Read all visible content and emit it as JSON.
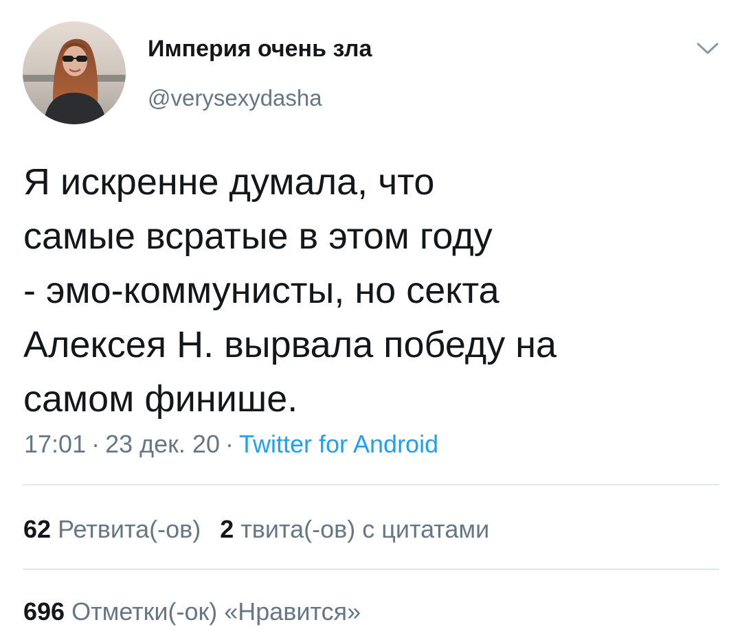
{
  "author": {
    "display_name": "Империя очень зла",
    "handle": "@verysexydasha"
  },
  "tweet": {
    "lines": [
      "Я искренне думала, что",
      "самые всратые в этом году",
      "- эмо-коммунисты, но секта",
      "Алексея Н. вырвала победу на",
      "самом финише."
    ],
    "time": "17:01",
    "date": "23 дек. 20",
    "separator": "·",
    "source": "Twitter for Android"
  },
  "stats": {
    "retweets_count": "62",
    "retweets_label": "Ретвита(-ов)",
    "quotes_count": "2",
    "quotes_label": "твита(-ов) с цитатами",
    "likes_count": "696",
    "likes_label": "Отметки(-ок) «Нравится»"
  },
  "icons": {
    "menu": "chevron-down-icon"
  },
  "colors": {
    "text": "#14171a",
    "secondary": "#657786",
    "link": "#1da1f2",
    "divider": "#e1e8ed"
  }
}
